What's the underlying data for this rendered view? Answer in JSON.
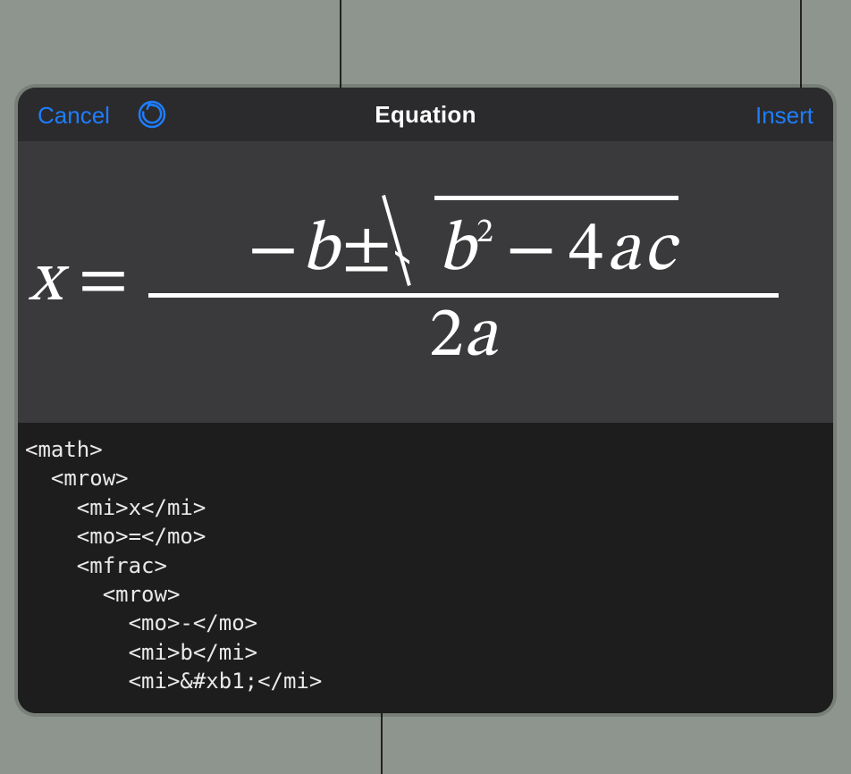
{
  "toolbar": {
    "cancel_label": "Cancel",
    "title": "Equation",
    "insert_label": "Insert"
  },
  "equation": {
    "lhs_var": "x",
    "equals": "=",
    "numer_minus": "−",
    "numer_b": "b",
    "numer_pm": "±",
    "rad_b": "b",
    "rad_pow": "2",
    "rad_minus": "−",
    "rad_4": "4",
    "rad_a": "a",
    "rad_c": "c",
    "denom_2": "2",
    "denom_a": "a"
  },
  "code": "<math>\n  <mrow>\n    <mi>x</mi>\n    <mo>=</mo>\n    <mfrac>\n      <mrow>\n        <mo>-</mo>\n        <mi>b</mi>\n        <mi>&#xb1;</mi>"
}
